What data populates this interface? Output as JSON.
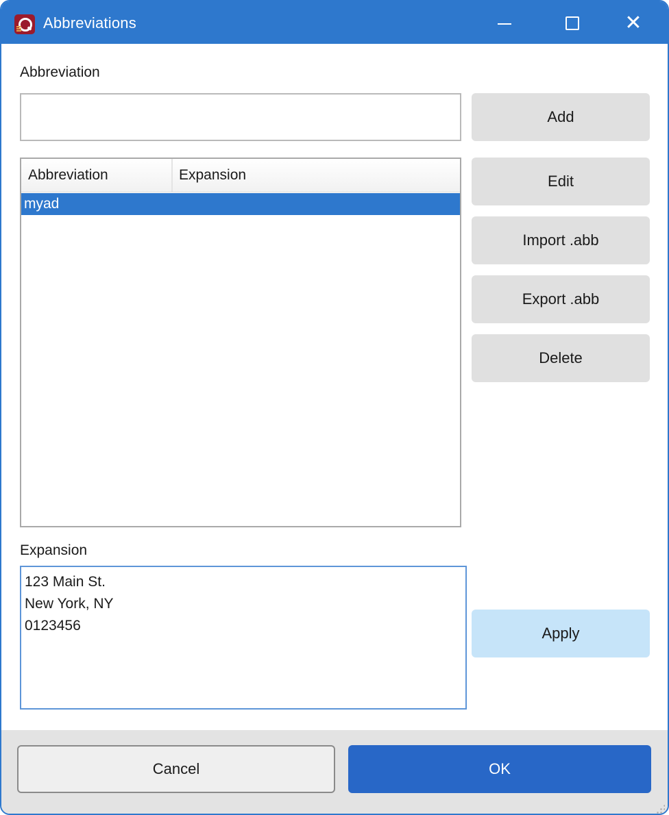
{
  "window": {
    "title": "Abbreviations",
    "app_icon": "app-logo-icon",
    "controls": {
      "minimize": "minimize-icon",
      "maximize": "maximize-icon",
      "close": "close-icon",
      "close_glyph": "✕"
    }
  },
  "abbreviation_field": {
    "label": "Abbreviation",
    "value": "",
    "placeholder": ""
  },
  "list": {
    "columns": [
      "Abbreviation",
      "Expansion"
    ],
    "rows": [
      {
        "abbreviation": "myad",
        "expansion": "",
        "selected": true
      }
    ]
  },
  "buttons": {
    "add": "Add",
    "edit": "Edit",
    "import": "Import .abb",
    "export": "Export .abb",
    "delete": "Delete",
    "apply": "Apply"
  },
  "expansion_field": {
    "label": "Expansion",
    "value": "123 Main St.\nNew York, NY\n0123456"
  },
  "footer": {
    "cancel": "Cancel",
    "ok": "OK"
  },
  "colors": {
    "titlebar": "#2e78cd",
    "selection": "#2e78cd",
    "ok_button": "#2867c7",
    "apply_button": "#c6e4f9"
  }
}
